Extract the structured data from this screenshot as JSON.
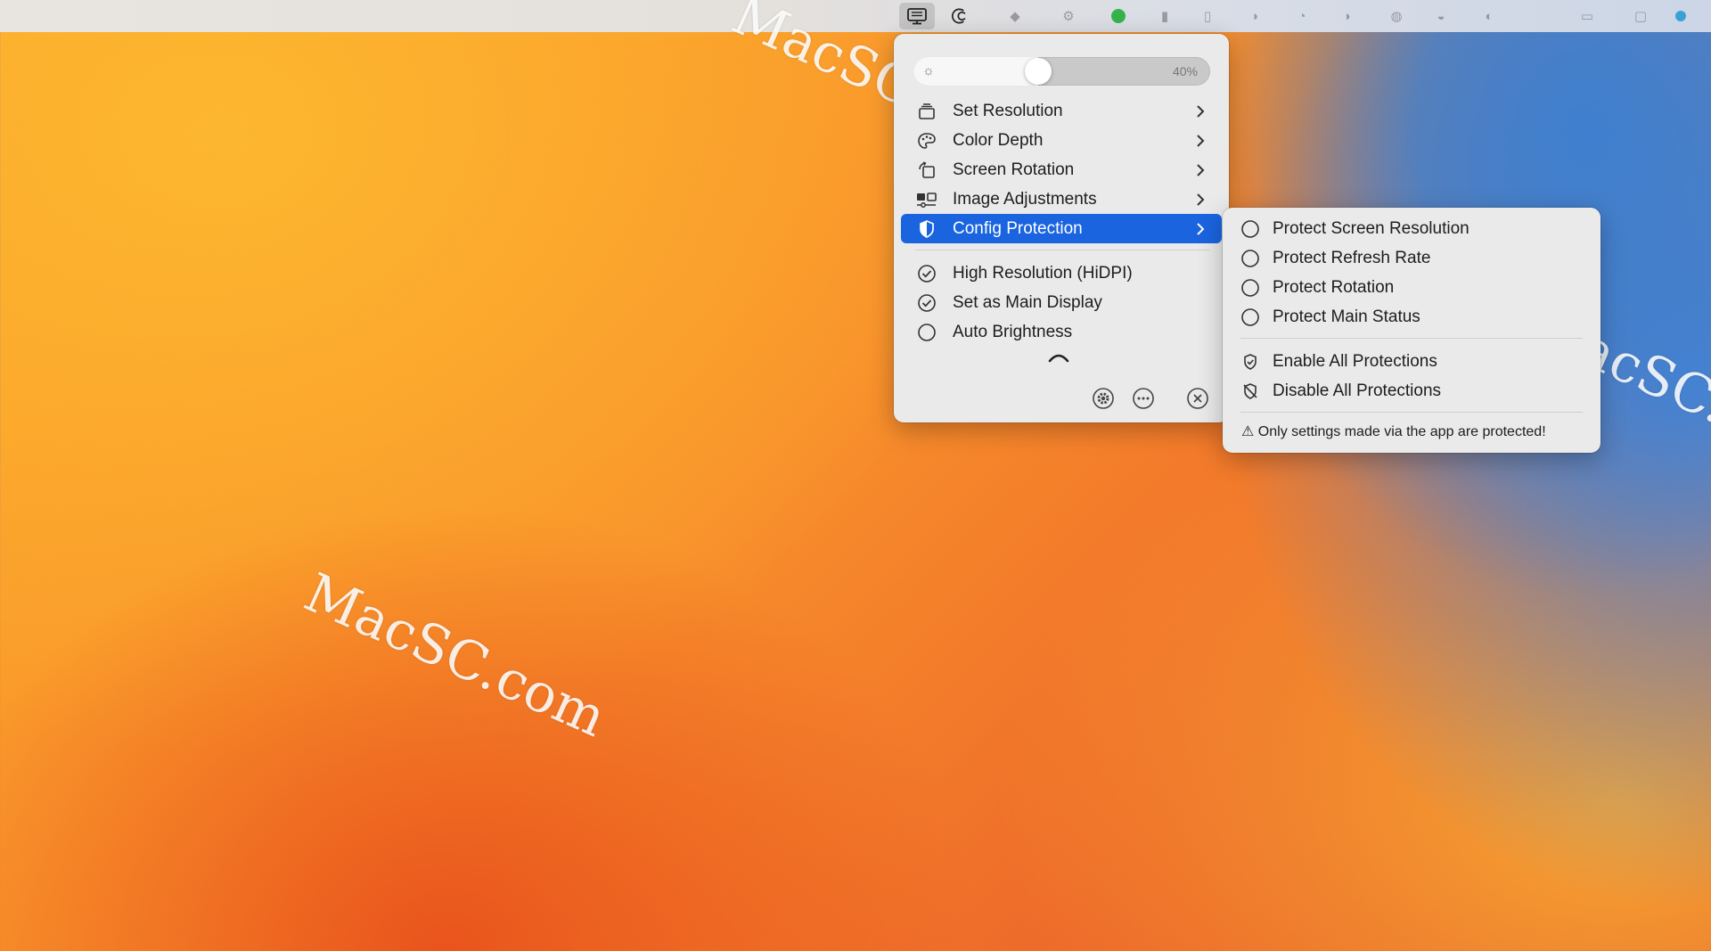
{
  "watermark": "MacSC.com",
  "slider": {
    "value": 0.4,
    "label": "40%"
  },
  "menu": {
    "items": [
      {
        "label": "Set Resolution",
        "icon": "display-stack-icon",
        "submenu": true
      },
      {
        "label": "Color Depth",
        "icon": "palette-icon",
        "submenu": true
      },
      {
        "label": "Screen Rotation",
        "icon": "rotate-icon",
        "submenu": true
      },
      {
        "label": "Image Adjustments",
        "icon": "sliders-icon",
        "submenu": true
      },
      {
        "label": "Config Protection",
        "icon": "shield-half-icon",
        "submenu": true,
        "highlighted": true
      }
    ],
    "toggles": [
      {
        "label": "High Resolution (HiDPI)",
        "checked": true
      },
      {
        "label": "Set as Main Display",
        "checked": true
      },
      {
        "label": "Auto Brightness",
        "checked": false
      }
    ],
    "footer": {
      "buttons": [
        "gear-icon",
        "more-icon",
        "close-circle-icon"
      ]
    }
  },
  "submenu": {
    "options": [
      {
        "label": "Protect Screen Resolution",
        "checked": false
      },
      {
        "label": "Protect Refresh Rate",
        "checked": false
      },
      {
        "label": "Protect Rotation",
        "checked": false
      },
      {
        "label": "Protect Main Status",
        "checked": false
      }
    ],
    "actions": [
      {
        "label": "Enable All Protections",
        "icon": "shield-check-icon"
      },
      {
        "label": "Disable All Protections",
        "icon": "shield-slash-icon"
      }
    ],
    "note": "⚠ Only settings made via the app are protected!"
  },
  "colors": {
    "highlight": "#1a64e0",
    "menu_bg": "#eaeaea"
  }
}
